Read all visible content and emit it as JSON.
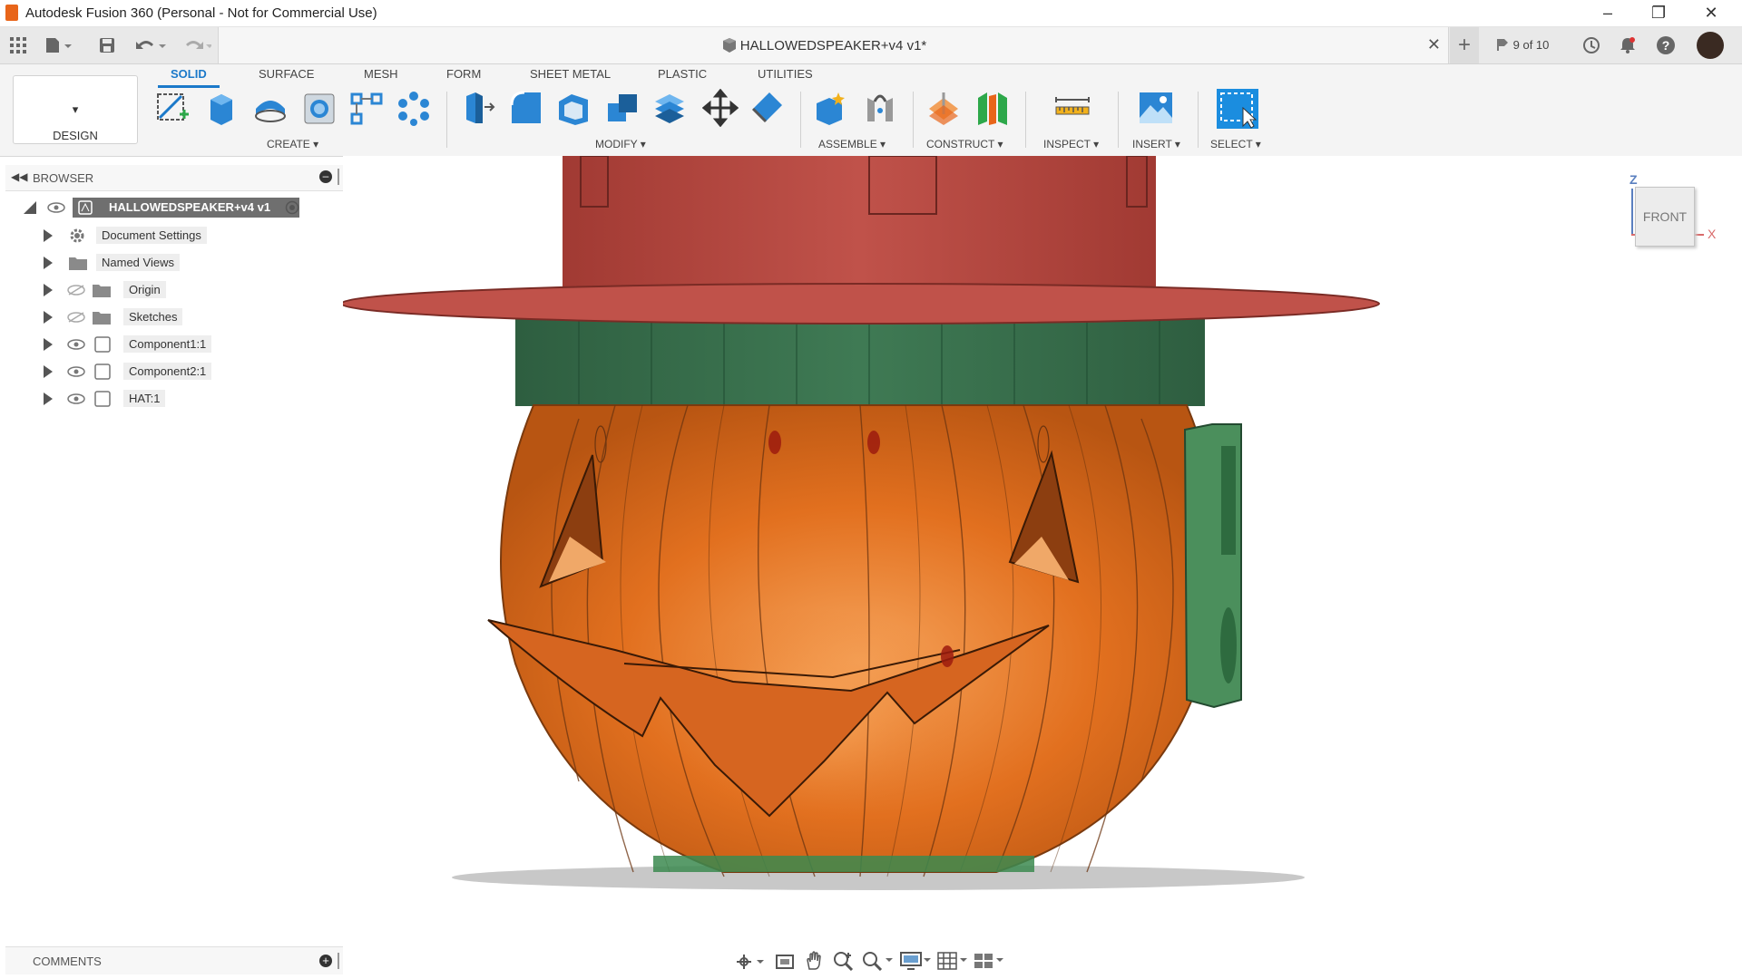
{
  "app": {
    "title": "Autodesk Fusion 360 (Personal - Not for Commercial Use)"
  },
  "document": {
    "tab_title": "HALLOWEDSPEAKER+v4 v1*",
    "version_badge": "9 of 10"
  },
  "ribbon": {
    "workspace_label": "DESIGN",
    "tabs": [
      "SOLID",
      "SURFACE",
      "MESH",
      "FORM",
      "SHEET METAL",
      "PLASTIC",
      "UTILITIES"
    ],
    "groups": [
      "CREATE",
      "MODIFY",
      "ASSEMBLE",
      "CONSTRUCT",
      "INSPECT",
      "INSERT",
      "SELECT"
    ]
  },
  "browser": {
    "title": "BROWSER",
    "root": "HALLOWEDSPEAKER+v4 v1",
    "items": [
      "Document Settings",
      "Named Views",
      "Origin",
      "Sketches",
      "Component1:1",
      "Component2:1",
      "HAT:1"
    ]
  },
  "viewcube": {
    "face": "FRONT",
    "axis_z": "Z",
    "axis_x": "X"
  },
  "comments": {
    "title": "COMMENTS"
  },
  "colors": {
    "accent": "#1b79c9",
    "pumpkin": "#e2701f",
    "hat": "#b8483f",
    "band": "#2f6b45"
  }
}
